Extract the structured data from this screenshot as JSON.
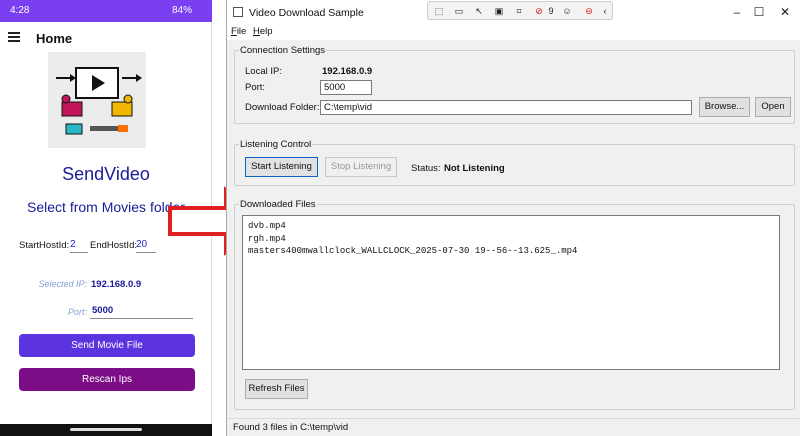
{
  "phone": {
    "status_time": "4:28",
    "status_battery": "84%",
    "appbar_title": "Home",
    "app_name": "SendVideo",
    "folder_title": "Select from Movies folder",
    "start_host_label": "StartHostId:",
    "start_host_value": "2",
    "end_host_label": "EndHostId:",
    "end_host_value": "20",
    "selected_ip_label": "Selected IP:",
    "selected_ip_value": "192.168.0.9",
    "port_label": "Port:",
    "port_value": "5000",
    "send_button": "Send Movie File",
    "rescan_button": "Rescan Ips",
    "colors": {
      "status_bar": "#7b3ff2",
      "send": "#5b34e0",
      "rescan": "#7b0e86",
      "text": "#1a1a9a"
    }
  },
  "window": {
    "title": "Video Download Sample",
    "toolbox_count": "9",
    "menu": [
      "File",
      "Help"
    ],
    "connection": {
      "legend": "Connection Settings",
      "local_ip_label": "Local IP:",
      "local_ip_value": "192.168.0.9",
      "port_label": "Port:",
      "port_value": "5000",
      "folder_label": "Download Folder:",
      "folder_value": "C:\\temp\\vid",
      "browse_button": "Browse...",
      "open_button": "Open"
    },
    "listening": {
      "legend": "Listening Control",
      "start_button": "Start Listening",
      "stop_button": "Stop Listening",
      "status_label": "Status:",
      "status_value": "Not Listening"
    },
    "downloaded": {
      "legend": "Downloaded Files",
      "files": [
        "dvb.mp4",
        "rgh.mp4",
        "masters400mwallclock_WALLCLOCK_2025-07-30 19--56--13.625_.mp4"
      ],
      "refresh_button": "Refresh Files"
    },
    "status_bar": "Found 3 files in C:\\temp\\vid"
  },
  "arrow_color": "#e02020"
}
